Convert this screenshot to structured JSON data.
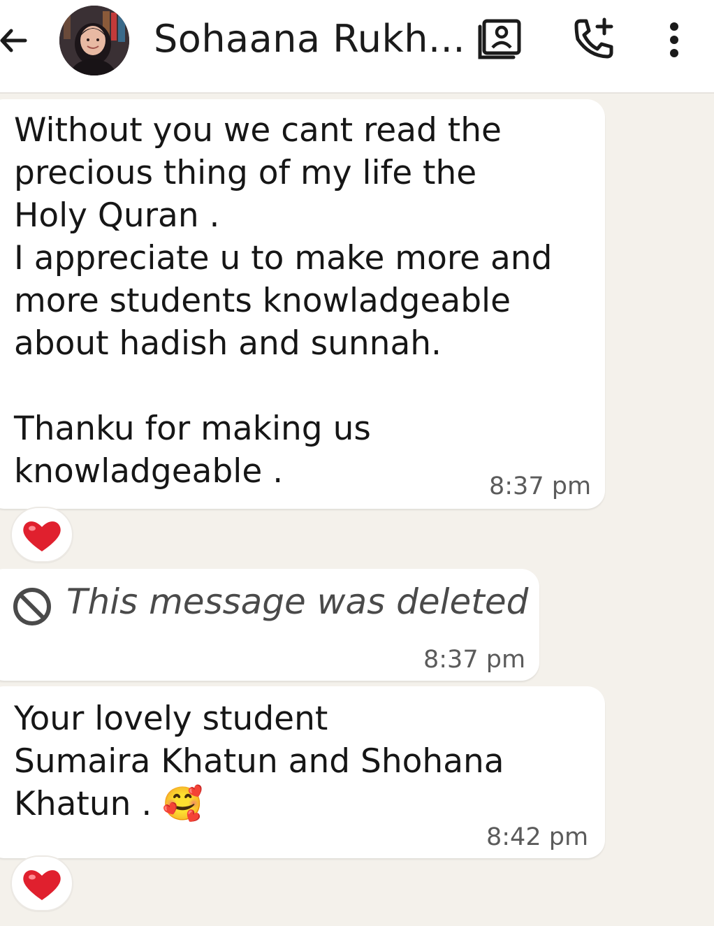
{
  "header": {
    "contact_name": "Sohaana Rukh...",
    "icons": [
      "back-arrow-icon",
      "avatar",
      "contact-card-icon",
      "add-call-icon",
      "more-options-icon"
    ]
  },
  "messages": [
    {
      "lines": [
        "Without you we cant read the",
        "precious thing of my life the",
        "Holy Quran .",
        "I appreciate u to make more and",
        "more students knowladgeable",
        "about hadish and sunnah.",
        "",
        "Thanku for making us",
        "knowladgeable ."
      ],
      "time": "8:37 pm",
      "reaction": "❤️"
    },
    {
      "deleted_text": "This message was deleted",
      "time": "8:37 pm",
      "icon": "deleted-icon"
    },
    {
      "lines": [
        "Your lovely student",
        "Sumaira Khatun and Shohana",
        "Khatun . 🥰"
      ],
      "time": "8:42 pm",
      "reaction": "❤️"
    }
  ],
  "colors": {
    "background": "#f4f1eb",
    "bubble": "#ffffff",
    "reaction_heart": "#e0202e"
  }
}
